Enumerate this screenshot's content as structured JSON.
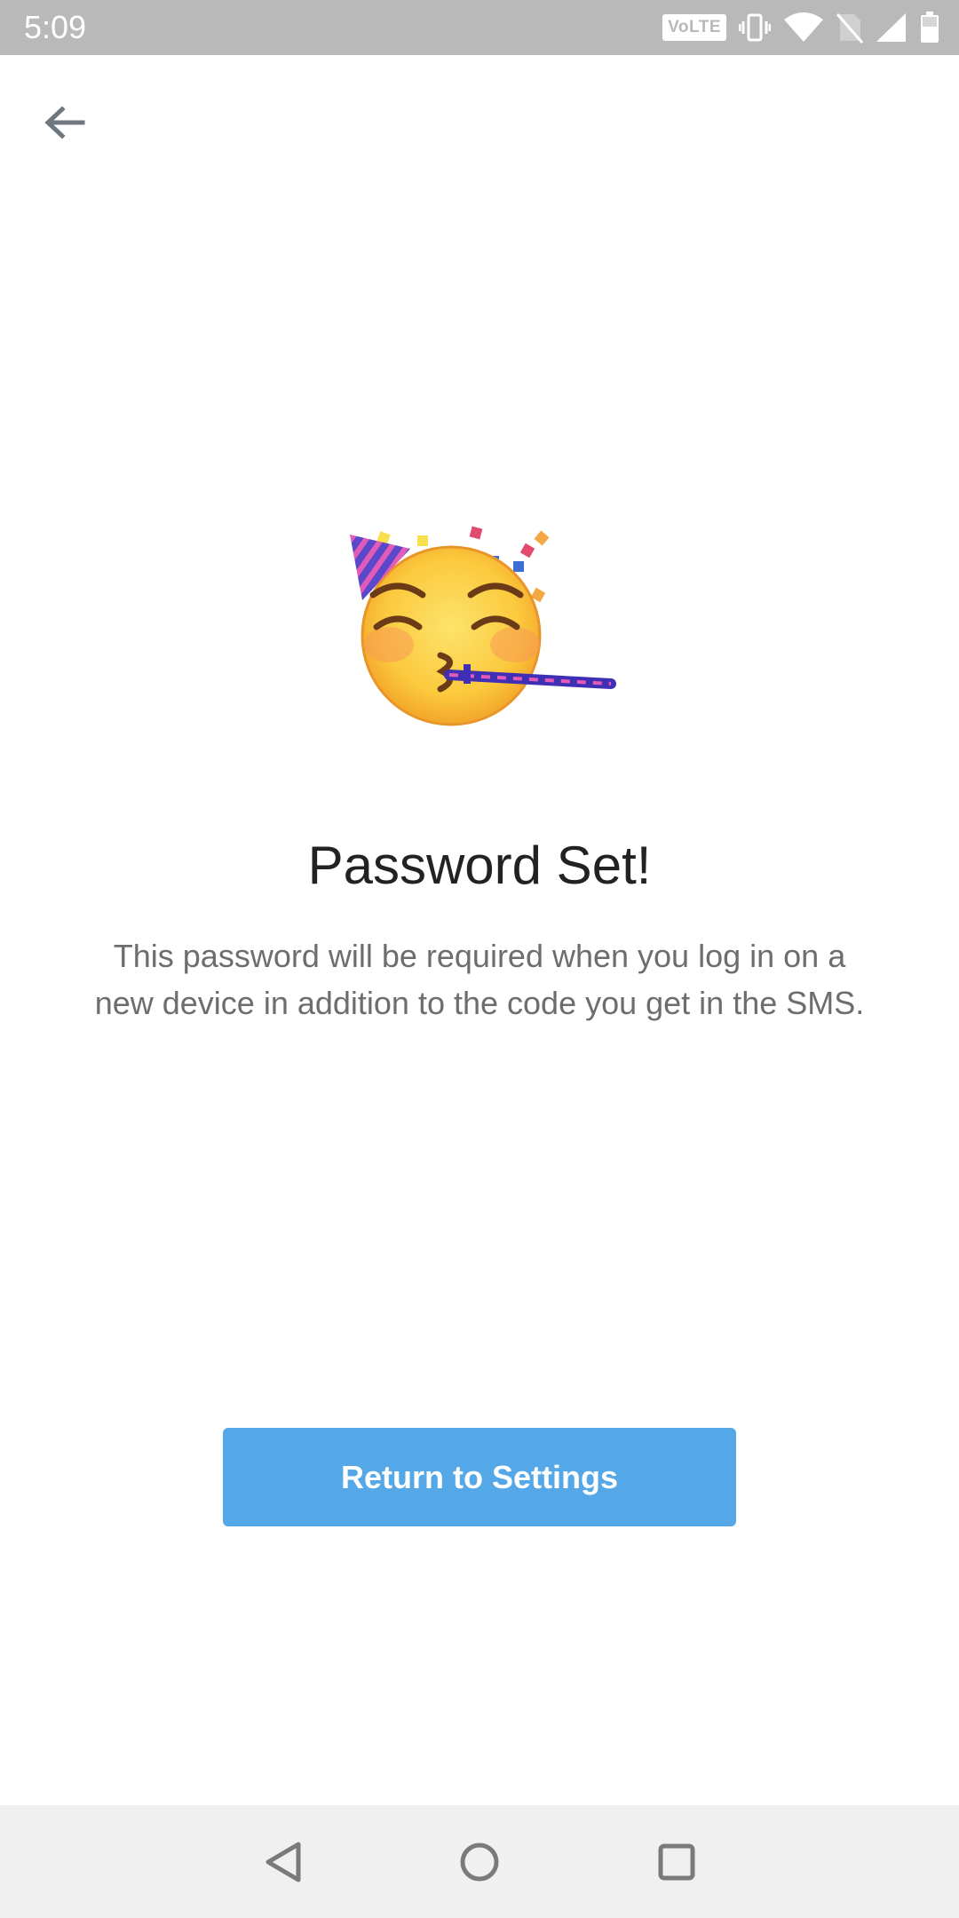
{
  "status_bar": {
    "time": "5:09",
    "network_badge": "VoLTE",
    "icons": [
      "vibrate-icon",
      "wifi-icon",
      "no-sim-icon",
      "signal-icon",
      "battery-icon"
    ]
  },
  "header": {
    "back_icon": "arrow-left-icon"
  },
  "content": {
    "illustration": "party-face-emoji",
    "title": "Password Set!",
    "description": "This password will be required when you log in on a new device in addition to the code you get in the SMS."
  },
  "actions": {
    "return_label": "Return to Settings"
  },
  "colors": {
    "accent": "#54a8e8",
    "status_bar": "#b9b9b9",
    "title_text": "#222222",
    "body_text": "#6d6d6d"
  },
  "nav_bar": {
    "buttons": [
      "back-triangle-icon",
      "home-circle-icon",
      "recents-square-icon"
    ]
  }
}
